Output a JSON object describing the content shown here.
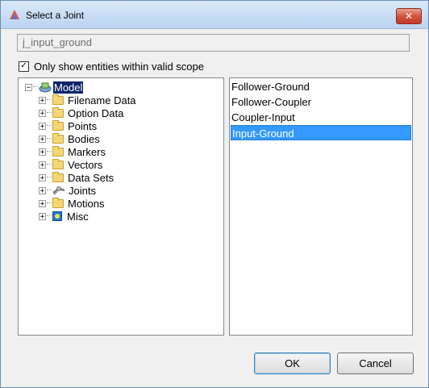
{
  "window": {
    "title": "Select a Joint",
    "close_label": "✕"
  },
  "name_field": {
    "value": "j_input_ground"
  },
  "scope": {
    "checked": true,
    "check_glyph": "✓",
    "label": "Only show entities within valid scope"
  },
  "tree": {
    "root": {
      "label": "Model",
      "expander": "−",
      "icon": "model-icon",
      "selected": true
    },
    "items": [
      {
        "label": "Filename Data",
        "icon": "folder-icon",
        "expander": "+"
      },
      {
        "label": "Option Data",
        "icon": "folder-icon",
        "expander": "+"
      },
      {
        "label": "Points",
        "icon": "folder-icon",
        "expander": "+"
      },
      {
        "label": "Bodies",
        "icon": "folder-icon",
        "expander": "+"
      },
      {
        "label": "Markers",
        "icon": "folder-icon",
        "expander": "+"
      },
      {
        "label": "Vectors",
        "icon": "folder-icon",
        "expander": "+"
      },
      {
        "label": "Data Sets",
        "icon": "folder-icon",
        "expander": "+"
      },
      {
        "label": "Joints",
        "icon": "joint-icon",
        "expander": "+"
      },
      {
        "label": "Motions",
        "icon": "folder-icon",
        "expander": "+"
      },
      {
        "label": "Misc",
        "icon": "misc-icon",
        "expander": "+"
      }
    ]
  },
  "list": {
    "items": [
      {
        "label": "Follower-Ground",
        "selected": false
      },
      {
        "label": "Follower-Coupler",
        "selected": false
      },
      {
        "label": "Coupler-Input",
        "selected": false
      },
      {
        "label": "Input-Ground",
        "selected": true
      }
    ]
  },
  "buttons": {
    "ok_label": "OK",
    "cancel_label": "Cancel"
  }
}
